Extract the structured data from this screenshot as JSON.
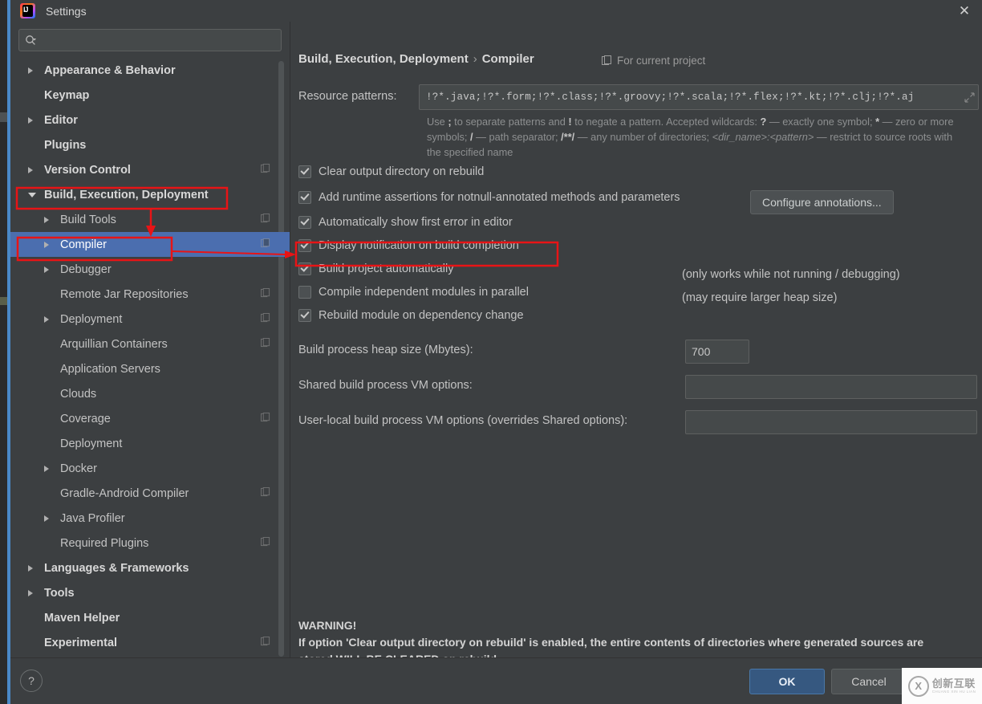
{
  "window": {
    "title": "Settings",
    "logo_icon": "intellij-idea-logo",
    "close_icon": "close-icon"
  },
  "sidebar": {
    "search": {
      "placeholder": "",
      "value": "",
      "icon": "search-icon",
      "dropdown_icon": "chevron-down-icon"
    },
    "items": [
      {
        "label": "Appearance & Behavior",
        "level": 0,
        "arrow": "right",
        "bold": true,
        "copy": false,
        "selected": false
      },
      {
        "label": "Keymap",
        "level": 0,
        "arrow": "none",
        "bold": true,
        "copy": false,
        "selected": false
      },
      {
        "label": "Editor",
        "level": 0,
        "arrow": "right",
        "bold": true,
        "copy": false,
        "selected": false
      },
      {
        "label": "Plugins",
        "level": 0,
        "arrow": "none",
        "bold": true,
        "copy": false,
        "selected": false
      },
      {
        "label": "Version Control",
        "level": 0,
        "arrow": "right",
        "bold": true,
        "copy": true,
        "selected": false
      },
      {
        "label": "Build, Execution, Deployment",
        "level": 0,
        "arrow": "down",
        "bold": true,
        "copy": false,
        "selected": false
      },
      {
        "label": "Build Tools",
        "level": 1,
        "arrow": "right",
        "bold": false,
        "copy": true,
        "selected": false
      },
      {
        "label": "Compiler",
        "level": 1,
        "arrow": "right",
        "bold": false,
        "copy": true,
        "selected": true
      },
      {
        "label": "Debugger",
        "level": 1,
        "arrow": "right",
        "bold": false,
        "copy": false,
        "selected": false
      },
      {
        "label": "Remote Jar Repositories",
        "level": 1,
        "arrow": "none",
        "bold": false,
        "copy": true,
        "selected": false
      },
      {
        "label": "Deployment",
        "level": 1,
        "arrow": "right",
        "bold": false,
        "copy": true,
        "selected": false
      },
      {
        "label": "Arquillian Containers",
        "level": 1,
        "arrow": "none",
        "bold": false,
        "copy": true,
        "selected": false
      },
      {
        "label": "Application Servers",
        "level": 1,
        "arrow": "none",
        "bold": false,
        "copy": false,
        "selected": false
      },
      {
        "label": "Clouds",
        "level": 1,
        "arrow": "none",
        "bold": false,
        "copy": false,
        "selected": false
      },
      {
        "label": "Coverage",
        "level": 1,
        "arrow": "none",
        "bold": false,
        "copy": true,
        "selected": false
      },
      {
        "label": "Deployment",
        "level": 1,
        "arrow": "none",
        "bold": false,
        "copy": false,
        "selected": false
      },
      {
        "label": "Docker",
        "level": 1,
        "arrow": "right",
        "bold": false,
        "copy": false,
        "selected": false
      },
      {
        "label": "Gradle-Android Compiler",
        "level": 1,
        "arrow": "none",
        "bold": false,
        "copy": true,
        "selected": false
      },
      {
        "label": "Java Profiler",
        "level": 1,
        "arrow": "right",
        "bold": false,
        "copy": false,
        "selected": false
      },
      {
        "label": "Required Plugins",
        "level": 1,
        "arrow": "none",
        "bold": false,
        "copy": true,
        "selected": false
      },
      {
        "label": "Languages & Frameworks",
        "level": 0,
        "arrow": "right",
        "bold": true,
        "copy": false,
        "selected": false
      },
      {
        "label": "Tools",
        "level": 0,
        "arrow": "right",
        "bold": true,
        "copy": false,
        "selected": false
      },
      {
        "label": "Maven Helper",
        "level": 0,
        "arrow": "none",
        "bold": true,
        "copy": false,
        "selected": false
      },
      {
        "label": "Experimental",
        "level": 0,
        "arrow": "none",
        "bold": true,
        "copy": true,
        "selected": false
      }
    ]
  },
  "main": {
    "breadcrumb_root": "Build, Execution, Deployment",
    "breadcrumb_sep": "›",
    "breadcrumb_leaf": "Compiler",
    "for_current_project": "For current project",
    "for_current_project_icon": "project-scope-icon",
    "resource_patterns_label": "Resource patterns:",
    "resource_patterns_value": "!?*.java;!?*.form;!?*.class;!?*.groovy;!?*.scala;!?*.flex;!?*.kt;!?*.clj;!?*.aj",
    "resource_patterns_placeholder": "",
    "expand_icon": "expand-editor-icon",
    "help_text_parts": {
      "p1": "Use ",
      "b1": ";",
      "p2": " to separate patterns and ",
      "b2": "!",
      "p3": " to negate a pattern. Accepted wildcards: ",
      "b3": "?",
      "p4": " — exactly one symbol; ",
      "b4": "*",
      "p5": " — zero or more symbols; ",
      "b5": "/",
      "p6": " — path separator; ",
      "b6": "/**/",
      "p7": " — any number of directories; ",
      "i1": "<dir_name>:<pattern>",
      "p8": " — restrict to source roots with the specified name"
    },
    "checkboxes": [
      {
        "label": "Clear output directory on rebuild",
        "checked": true,
        "mnemonic": "l"
      },
      {
        "label": "Add runtime assertions for notnull-annotated methods and parameters",
        "checked": true,
        "mnemonic": "a"
      },
      {
        "label": "Automatically show first error in editor",
        "checked": true,
        "mnemonic": "e"
      },
      {
        "label": "Display notification on build completion",
        "checked": true,
        "mnemonic": ""
      },
      {
        "label": "Build project automatically",
        "checked": true,
        "mnemonic": ""
      },
      {
        "label": "Compile independent modules in parallel",
        "checked": false,
        "mnemonic": ""
      },
      {
        "label": "Rebuild module on dependency change",
        "checked": true,
        "mnemonic": ""
      }
    ],
    "configure_annotations_button": "Configure annotations...",
    "note_auto_build": "(only works while not running / debugging)",
    "note_parallel": "(may require larger heap size)",
    "heap_label": "Build process heap size (Mbytes):",
    "heap_value": "700",
    "shared_vm_label": "Shared build process VM options:",
    "shared_vm_value": "",
    "user_vm_label": "User-local build process VM options (overrides Shared options):",
    "user_vm_value": "",
    "warning_title": "WARNING!",
    "warning_body": "If option 'Clear output directory on rebuild' is enabled, the entire contents of directories where generated sources are stored WILL BE CLEARED on rebuild."
  },
  "footer": {
    "help_label": "?",
    "ok_label": "OK",
    "cancel_label": "Cancel"
  },
  "watermark": {
    "mark": "X",
    "cn": "创新互联",
    "en": "CHUANG XIN HU LIAN"
  },
  "colors": {
    "accent_selection": "#4b6eaf",
    "ok_button": "#365880",
    "annotation_red": "#e81416",
    "panel_bg": "#3c3f41",
    "field_bg": "#45494a"
  }
}
